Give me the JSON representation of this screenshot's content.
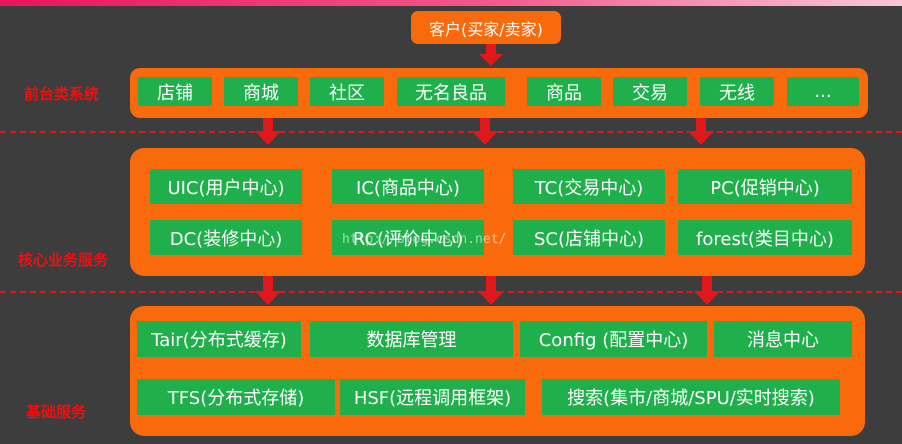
{
  "customer": "客户(买家/卖家)",
  "layers": {
    "frontend": {
      "label": "前台类系统",
      "items": [
        "店铺",
        "商城",
        "社区",
        "无名良品",
        "商品",
        "交易",
        "无线",
        "..."
      ]
    },
    "core": {
      "label": "核心业务服务",
      "items": [
        "UIC(用户中心)",
        "IC(商品中心)",
        "TC(交易中心)",
        "PC(促销中心)",
        "DC(装修中心)",
        "RC(评价中心)",
        "SC(店铺中心)",
        "forest(类目中心)"
      ]
    },
    "base": {
      "label": "基础服务",
      "items": [
        "Tair(分布式缓存)",
        "数据库管理",
        "Config (配置中心)",
        "消息中心",
        "TFS(分布式存储)",
        "HSF(远程调用框架)",
        "搜索(集市/商城/SPU/实时搜索)"
      ]
    }
  },
  "watermark": "http://blog.csdn.net/",
  "colors": {
    "background": "#3d3d3d",
    "layer": "#f86a0c",
    "box": "#1fb04c",
    "label": "#ee1010",
    "divider": "#e0181c"
  }
}
